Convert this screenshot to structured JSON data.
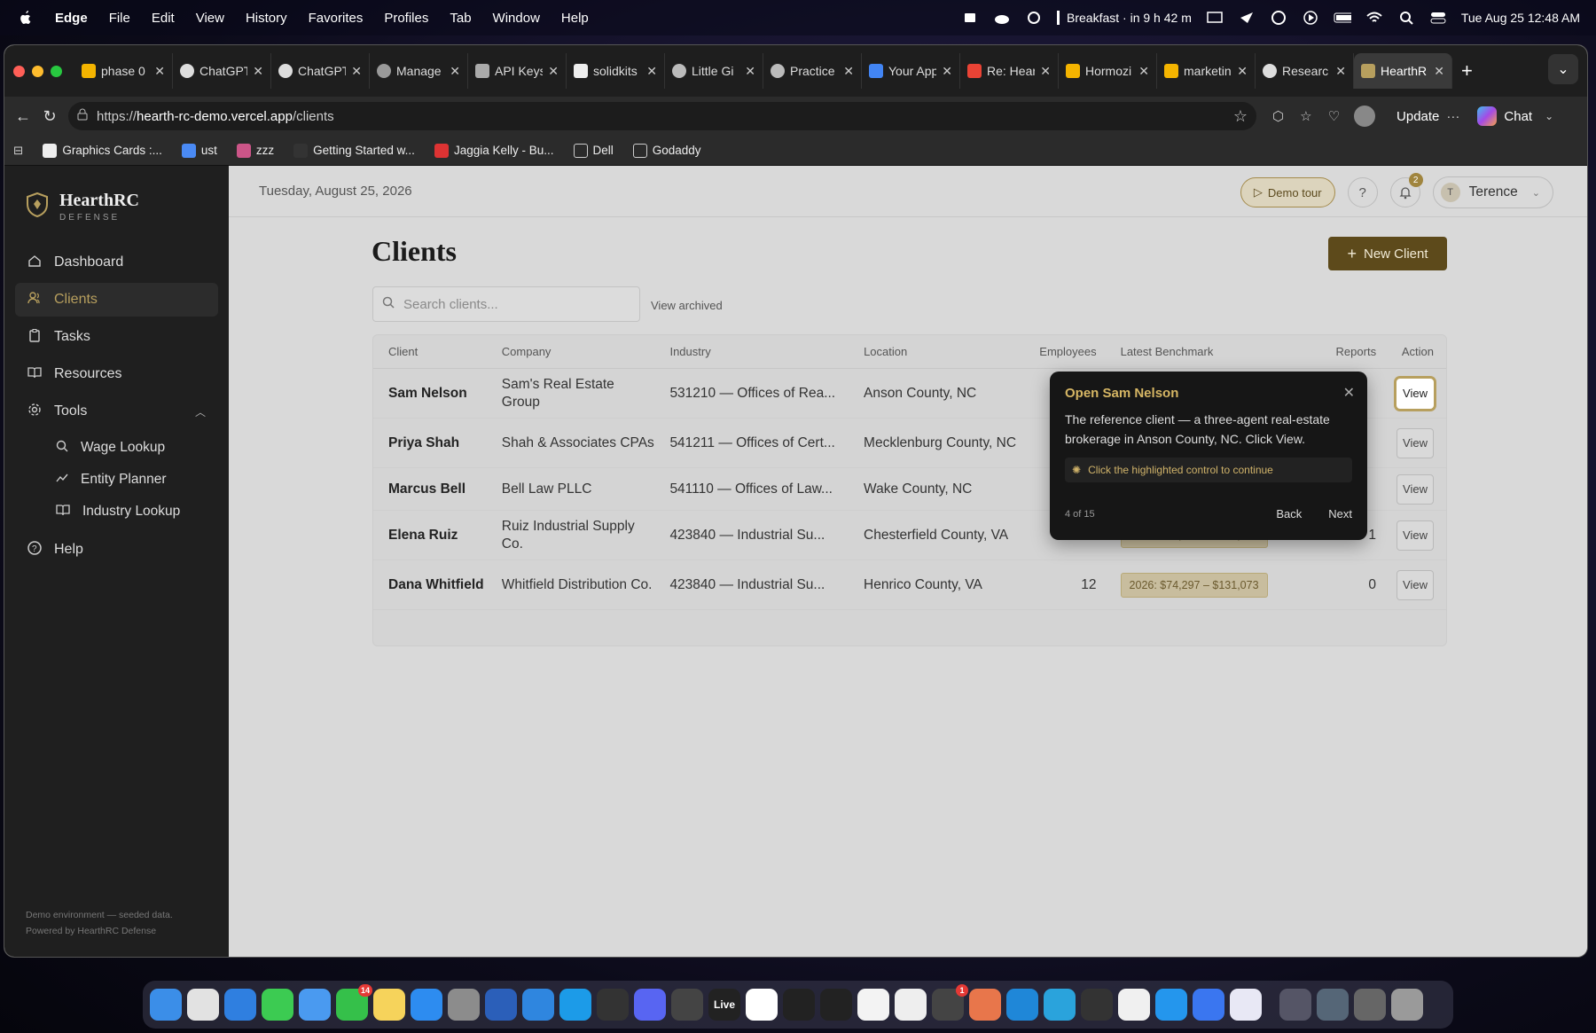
{
  "menubar": {
    "app": "Edge",
    "items": [
      "File",
      "Edit",
      "View",
      "History",
      "Favorites",
      "Profiles",
      "Tab",
      "Window",
      "Help"
    ],
    "event": "Breakfast · in 9 h 42 m",
    "datetime": "Tue Aug 25  12:48 AM"
  },
  "browser": {
    "tabs": [
      {
        "label": "phase 0",
        "icon": "drive-icon"
      },
      {
        "label": "ChatGPT",
        "icon": "chatgpt-icon"
      },
      {
        "label": "ChatGPT",
        "icon": "chatgpt-icon"
      },
      {
        "label": "Manage",
        "icon": "globe-icon"
      },
      {
        "label": "API Keys",
        "icon": "key-icon"
      },
      {
        "label": "solidkits",
        "icon": "github-icon"
      },
      {
        "label": "Little Gi",
        "icon": "circle-icon"
      },
      {
        "label": "Practice",
        "icon": "circle-icon"
      },
      {
        "label": "Your App",
        "icon": "google-icon"
      },
      {
        "label": "Re: Hear",
        "icon": "gmail-icon"
      },
      {
        "label": "Hormozi",
        "icon": "drive-icon"
      },
      {
        "label": "marketin",
        "icon": "drive-icon"
      },
      {
        "label": "Researc",
        "icon": "chatgpt-icon"
      },
      {
        "label": "HearthR",
        "icon": "shield-icon"
      }
    ],
    "url_prefix": "https://",
    "url_host": "hearth-rc-demo.vercel.app",
    "url_path": "/clients",
    "update_label": "Update",
    "chat_label": "Chat",
    "bookmarks": [
      {
        "label": "Graphics Cards :...",
        "icon": "page-icon"
      },
      {
        "label": "ust",
        "icon": "doc-icon"
      },
      {
        "label": "zzz",
        "icon": "image-icon"
      },
      {
        "label": "Getting Started w...",
        "icon": "d2l-icon"
      },
      {
        "label": "Jaggia Kelly - Bu...",
        "icon": "pdf-icon"
      },
      {
        "label": "Dell",
        "icon": "folder-icon"
      },
      {
        "label": "Godaddy",
        "icon": "folder-icon"
      }
    ]
  },
  "sidebar": {
    "brand_name": "HearthRC",
    "brand_sub": "DEFENSE",
    "nav": [
      {
        "label": "Dashboard",
        "icon": "home-icon"
      },
      {
        "label": "Clients",
        "icon": "users-icon"
      },
      {
        "label": "Tasks",
        "icon": "clipboard-icon"
      },
      {
        "label": "Resources",
        "icon": "book-icon"
      },
      {
        "label": "Tools",
        "icon": "gear-icon"
      }
    ],
    "tools_sub": [
      {
        "label": "Wage Lookup",
        "icon": "search-icon"
      },
      {
        "label": "Entity Planner",
        "icon": "trend-icon"
      },
      {
        "label": "Industry Lookup",
        "icon": "book-icon"
      }
    ],
    "help": "Help",
    "footer_line1": "Demo environment — seeded data.",
    "footer_line2": "Powered by HearthRC Defense"
  },
  "header": {
    "date": "Tuesday, August 25, 2026",
    "demo_tour": "Demo tour",
    "help_symbol": "?",
    "notif_count": "2",
    "user_initial": "T",
    "user_name": "Terence"
  },
  "page": {
    "title": "Clients",
    "new_client": "New Client",
    "search_placeholder": "Search clients...",
    "view_archived": "View archived"
  },
  "table": {
    "columns": [
      "Client",
      "Company",
      "Industry",
      "Location",
      "Employees",
      "Latest Benchmark",
      "Reports",
      "Action"
    ],
    "rows": [
      {
        "client": "Sam Nelson",
        "company": "Sam's Real Estate Group",
        "industry": "531210 — Offices of Rea...",
        "location": "Anson County, NC",
        "employees": "",
        "benchmark": "",
        "reports": "",
        "action": "View"
      },
      {
        "client": "Priya Shah",
        "company": "Shah & Associates CPAs",
        "industry": "541211 — Offices of Cert...",
        "location": "Mecklenburg County, NC",
        "employees": "",
        "benchmark": "",
        "reports": "",
        "action": "View"
      },
      {
        "client": "Marcus Bell",
        "company": "Bell Law PLLC",
        "industry": "541110 — Offices of Law...",
        "location": "Wake County, NC",
        "employees": "",
        "benchmark": "",
        "reports": "",
        "action": "View"
      },
      {
        "client": "Elena Ruiz",
        "company": "Ruiz Industrial Supply Co.",
        "industry": "423840 — Industrial Su...",
        "location": "Chesterfield County, VA",
        "employees": "15",
        "benchmark": "2026: $75,883 – $133,873",
        "reports": "1",
        "action": "View"
      },
      {
        "client": "Dana Whitfield",
        "company": "Whitfield Distribution Co.",
        "industry": "423840 — Industrial Su...",
        "location": "Henrico County, VA",
        "employees": "12",
        "benchmark": "2026: $74,297 – $131,073",
        "reports": "0",
        "action": "View"
      }
    ]
  },
  "tour": {
    "title": "Open Sam Nelson",
    "body": "The reference client — a three-agent real-estate brokerage in Anson County, NC. Click View.",
    "hint": "Click the highlighted control to continue",
    "step": "4 of 15",
    "back": "Back",
    "next": "Next"
  },
  "dock": {
    "apps": [
      {
        "name": "finder-icon",
        "color": "#3b8ee8"
      },
      {
        "name": "launchpad-icon",
        "color": "#e2e2e2"
      },
      {
        "name": "safari-icon",
        "color": "#2f7fe0"
      },
      {
        "name": "messages-icon",
        "color": "#3ccb52"
      },
      {
        "name": "mail-icon",
        "color": "#4a9af0"
      },
      {
        "name": "facetime-icon",
        "color": "#35c04a",
        "badge": "14"
      },
      {
        "name": "notes-icon",
        "color": "#f6d35b"
      },
      {
        "name": "appstore-icon",
        "color": "#2d8cf0"
      },
      {
        "name": "settings-icon",
        "color": "#8c8c8c"
      },
      {
        "name": "word-icon",
        "color": "#2b5fb9"
      },
      {
        "name": "onedrive-icon",
        "color": "#2f86df"
      },
      {
        "name": "edge-icon",
        "color": "#1c9be8"
      },
      {
        "name": "obs-icon",
        "color": "#333333"
      },
      {
        "name": "discord-icon",
        "color": "#5865f2"
      },
      {
        "name": "davinci-icon",
        "color": "#444444"
      },
      {
        "name": "live-icon",
        "color": "#222222",
        "text": "Live"
      },
      {
        "name": "notion-icon",
        "color": "#ffffff"
      },
      {
        "name": "activity-monitor-icon",
        "color": "#222222"
      },
      {
        "name": "terminal-icon",
        "color": "#222222"
      },
      {
        "name": "drive-icon",
        "color": "#f3f3f3"
      },
      {
        "name": "textedit-icon",
        "color": "#eeeeee"
      },
      {
        "name": "chatgpt-icon",
        "color": "#444444",
        "badge": "1"
      },
      {
        "name": "claude-icon",
        "color": "#e8764b"
      },
      {
        "name": "vscode-icon",
        "color": "#1f87d8"
      },
      {
        "name": "telegram-icon",
        "color": "#2aa3dc"
      },
      {
        "name": "cube-icon",
        "color": "#333333"
      },
      {
        "name": "calendar-icon",
        "color": "#f0f0f0"
      },
      {
        "name": "docker-icon",
        "color": "#2496ed"
      },
      {
        "name": "signal-icon",
        "color": "#3a76f0"
      },
      {
        "name": "xcode-icon",
        "color": "#e8e8f5"
      },
      {
        "name": "window-icon",
        "color": "#555566"
      },
      {
        "name": "window-icon",
        "color": "#556677"
      },
      {
        "name": "window-icon",
        "color": "#666666"
      },
      {
        "name": "trash-icon",
        "color": "#9a9a9a"
      }
    ]
  }
}
